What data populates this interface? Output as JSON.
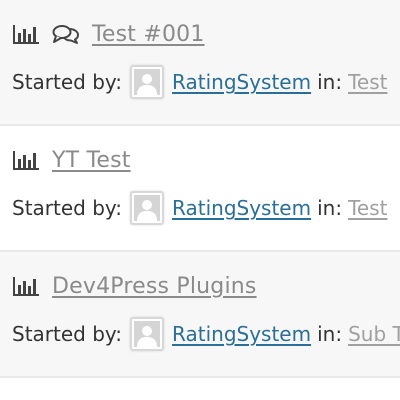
{
  "topics": [
    {
      "icons": [
        "bar-chart-icon",
        "chat-bubbles-icon"
      ],
      "title": "Test #001",
      "started_by_label": "Started by:",
      "author": "RatingSystem",
      "in_label": "in:",
      "forum": "Test"
    },
    {
      "icons": [
        "bar-chart-icon"
      ],
      "title": "YT Test",
      "started_by_label": "Started by:",
      "author": "RatingSystem",
      "in_label": "in:",
      "forum": "Test"
    },
    {
      "icons": [
        "bar-chart-icon"
      ],
      "title": "Dev4Press Plugins",
      "started_by_label": "Started by:",
      "author": "RatingSystem",
      "in_label": "in:",
      "forum": "Sub T"
    }
  ],
  "colors": {
    "link": "#2a6f97",
    "title": "#8a8a8a",
    "forum_link": "#a0a0a0",
    "row_alt_bg": "#f7f7f7"
  }
}
